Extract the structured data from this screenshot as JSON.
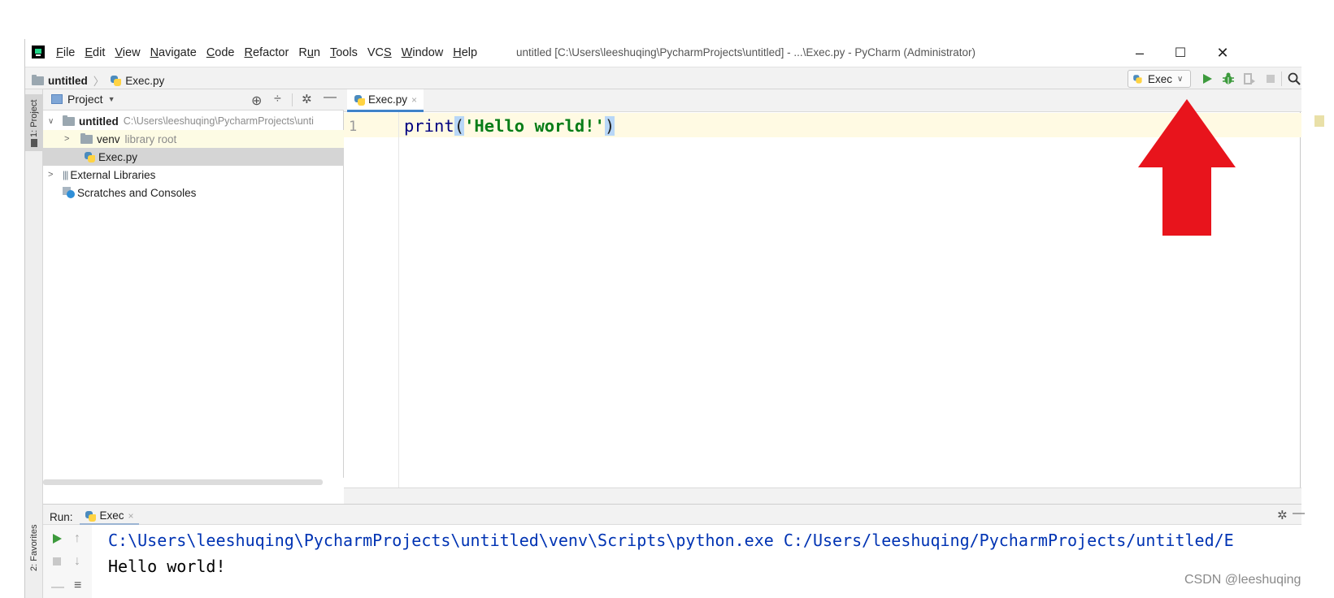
{
  "app": {
    "window_title": "untitled [C:\\Users\\leeshuqing\\PycharmProjects\\untitled] - ...\\Exec.py - PyCharm (Administrator)",
    "menus": [
      {
        "mn": "F",
        "rest": "ile"
      },
      {
        "mn": "E",
        "rest": "dit"
      },
      {
        "mn": "V",
        "rest": "iew"
      },
      {
        "mn": "N",
        "rest": "avigate"
      },
      {
        "mn": "C",
        "rest": "ode"
      },
      {
        "mn": "R",
        "rest": "efactor"
      },
      {
        "pre": "R",
        "mn": "u",
        "rest": "n"
      },
      {
        "mn": "T",
        "rest": "ools"
      },
      {
        "pre": "VC",
        "mn": "S",
        "rest": ""
      },
      {
        "mn": "W",
        "rest": "indow"
      },
      {
        "mn": "H",
        "rest": "elp"
      }
    ],
    "window_controls": {
      "minimize": "–",
      "maximize": "☐",
      "close": "✕"
    }
  },
  "navbar": {
    "project": "untitled",
    "file": "Exec.py",
    "run_config": "Exec"
  },
  "side_tabs": {
    "project": "1: Project",
    "favorites": "2: Favorites"
  },
  "project_panel": {
    "title": "Project",
    "tree": [
      {
        "name": "untitled",
        "hint": "C:\\Users\\leeshuqing\\PycharmProjects\\unti",
        "kind": "folder-root"
      },
      {
        "name": "venv",
        "hint": "library root",
        "kind": "folder"
      },
      {
        "name": "Exec.py",
        "hint": "",
        "kind": "py-file"
      },
      {
        "name": "External Libraries",
        "hint": "",
        "kind": "libraries"
      },
      {
        "name": "Scratches and Consoles",
        "hint": "",
        "kind": "scratches"
      }
    ]
  },
  "editor": {
    "tab": "Exec.py",
    "line_number": "1",
    "code_func": "print",
    "code_open": "(",
    "code_string": "'Hello world!'",
    "code_close": ")"
  },
  "run_panel": {
    "label": "Run:",
    "tab": "Exec",
    "output": [
      "C:\\Users\\leeshuqing\\PycharmProjects\\untitled\\venv\\Scripts\\python.exe C:/Users/leeshuqing/PycharmProjects/untitled/E",
      "Hello world!"
    ]
  },
  "watermark": "CSDN @leeshuqing",
  "colors": {
    "run_green": "#3d9a3d",
    "annotation_red": "#e8141c",
    "string_green": "#067d17",
    "keyword_navy": "#000080",
    "console_blue": "#0033b3",
    "brace_highlight": "#b8d7f7"
  }
}
